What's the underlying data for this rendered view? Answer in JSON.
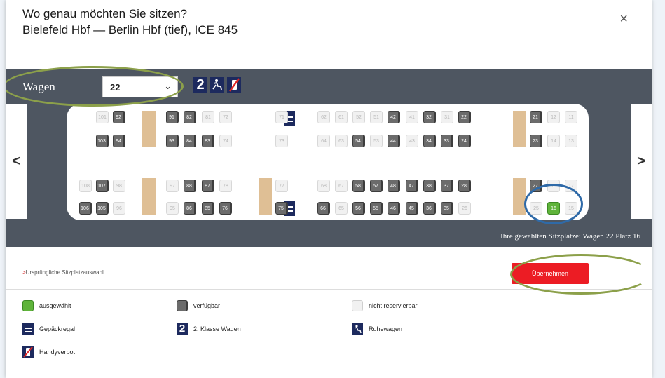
{
  "dialog": {
    "title": "Wo genau möchten Sie sitzen?",
    "subtitle": "Bielefeld Hbf — Berlin Hbf (tief), ICE 845",
    "close_icon": "×"
  },
  "toolbar": {
    "wagen_label": "Wagen",
    "wagen_value": "22",
    "chevron": "⌄",
    "badge_class": "2",
    "badge_ruhe_icon": "ruhewagen-icon",
    "badge_handy_icon": "handyverbot-icon"
  },
  "nav": {
    "prev": "<",
    "next": ">"
  },
  "seats": {
    "upper_window": [
      {
        "n": "101",
        "s": "na"
      },
      {
        "n": "92",
        "s": "av"
      },
      {
        "n": "91",
        "s": "av"
      },
      {
        "n": "82",
        "s": "av"
      },
      {
        "n": "81",
        "s": "na"
      },
      {
        "n": "72",
        "s": "na"
      },
      {
        "n": "71",
        "s": "na"
      },
      {
        "n": "62",
        "s": "na"
      },
      {
        "n": "61",
        "s": "na"
      },
      {
        "n": "52",
        "s": "na"
      },
      {
        "n": "51",
        "s": "na"
      },
      {
        "n": "42",
        "s": "av"
      },
      {
        "n": "41",
        "s": "na"
      },
      {
        "n": "32",
        "s": "av"
      },
      {
        "n": "31",
        "s": "na"
      },
      {
        "n": "22",
        "s": "av"
      },
      {
        "n": "21",
        "s": "av"
      },
      {
        "n": "12",
        "s": "na"
      },
      {
        "n": "11",
        "s": "na"
      }
    ],
    "upper_aisle": [
      {
        "n": "103",
        "s": "av"
      },
      {
        "n": "94",
        "s": "av"
      },
      {
        "n": "93",
        "s": "av"
      },
      {
        "n": "84",
        "s": "av"
      },
      {
        "n": "83",
        "s": "av"
      },
      {
        "n": "74",
        "s": "na"
      },
      {
        "n": "73",
        "s": "na"
      },
      {
        "n": "64",
        "s": "na"
      },
      {
        "n": "63",
        "s": "na"
      },
      {
        "n": "54",
        "s": "av"
      },
      {
        "n": "53",
        "s": "na"
      },
      {
        "n": "44",
        "s": "av"
      },
      {
        "n": "43",
        "s": "na"
      },
      {
        "n": "34",
        "s": "av"
      },
      {
        "n": "33",
        "s": "av"
      },
      {
        "n": "24",
        "s": "av"
      },
      {
        "n": "23",
        "s": "av"
      },
      {
        "n": "14",
        "s": "na"
      },
      {
        "n": "13",
        "s": "na"
      }
    ],
    "lower_aisle": [
      {
        "n": "108",
        "s": "na"
      },
      {
        "n": "107",
        "s": "av"
      },
      {
        "n": "98",
        "s": "na"
      },
      {
        "n": "97",
        "s": "na"
      },
      {
        "n": "88",
        "s": "av"
      },
      {
        "n": "87",
        "s": "av"
      },
      {
        "n": "78",
        "s": "na"
      },
      {
        "n": "77",
        "s": "na"
      },
      {
        "n": "68",
        "s": "na"
      },
      {
        "n": "67",
        "s": "na"
      },
      {
        "n": "58",
        "s": "av"
      },
      {
        "n": "57",
        "s": "av"
      },
      {
        "n": "48",
        "s": "av"
      },
      {
        "n": "47",
        "s": "av"
      },
      {
        "n": "38",
        "s": "av"
      },
      {
        "n": "37",
        "s": "av"
      },
      {
        "n": "28",
        "s": "av"
      },
      {
        "n": "27",
        "s": "av"
      },
      {
        "n": "18",
        "s": "na"
      },
      {
        "n": "17",
        "s": "na"
      }
    ],
    "lower_window": [
      {
        "n": "106",
        "s": "av"
      },
      {
        "n": "105",
        "s": "av"
      },
      {
        "n": "96",
        "s": "na"
      },
      {
        "n": "95",
        "s": "na"
      },
      {
        "n": "86",
        "s": "av"
      },
      {
        "n": "85",
        "s": "av"
      },
      {
        "n": "76",
        "s": "av"
      },
      {
        "n": "75",
        "s": "av"
      },
      {
        "n": "66",
        "s": "av"
      },
      {
        "n": "65",
        "s": "na"
      },
      {
        "n": "56",
        "s": "av"
      },
      {
        "n": "55",
        "s": "av"
      },
      {
        "n": "46",
        "s": "av"
      },
      {
        "n": "45",
        "s": "av"
      },
      {
        "n": "36",
        "s": "av"
      },
      {
        "n": "35",
        "s": "av"
      },
      {
        "n": "26",
        "s": "na"
      },
      {
        "n": "25",
        "s": "na"
      },
      {
        "n": "16",
        "s": "sel"
      },
      {
        "n": "15",
        "s": "na"
      }
    ]
  },
  "summary": "Ihre gewählten Sitzplätze:  Wagen 22   Platz 16",
  "footer": {
    "original_link": "Ursprüngliche Sitzplatzauswahl",
    "original_arrow": ">",
    "confirm_button": "Übernehmen"
  },
  "legend": {
    "selected": "ausgewählt",
    "available": "verfügbar",
    "not_reservable": "nicht reservierbar",
    "luggage": "Gepäckregal",
    "second_class": "2. Klasse Wagen",
    "second_class_badge": "2",
    "quiet": "Ruhewagen",
    "phone_ban": "Handyverbot"
  },
  "colors": {
    "band": "#4e5661",
    "available": "#6b6b6b",
    "selected": "#5fb43a",
    "navy": "#1d2a5e",
    "confirm": "#ec1c24",
    "annotation_green": "#8ca04a",
    "annotation_blue": "#2f6aa8"
  }
}
